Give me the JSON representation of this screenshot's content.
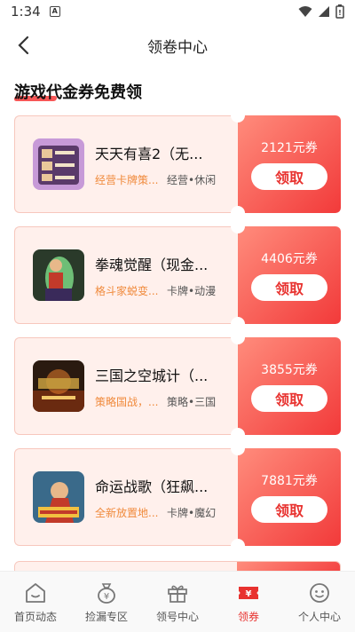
{
  "status_bar": {
    "time": "1:34",
    "badge": "A"
  },
  "nav": {
    "title": "领卷中心"
  },
  "section": {
    "title": "游戏代金券免费领"
  },
  "coupons": [
    {
      "name": "天天有喜2（无...",
      "desc": "经营卡牌策...",
      "tags": "经营•休闲",
      "amount": "2121元券",
      "button": "领取",
      "icon": "game-icon-tiantian"
    },
    {
      "name": "拳魂觉醒（现金...",
      "desc": "格斗家蜕变...",
      "tags": "卡牌•动漫",
      "amount": "4406元券",
      "button": "领取",
      "icon": "game-icon-quanhun"
    },
    {
      "name": "三国之空城计（...",
      "desc": "策略国战，...",
      "tags": "策略•三国",
      "amount": "3855元券",
      "button": "领取",
      "icon": "game-icon-sanguo"
    },
    {
      "name": "命运战歌（狂飙...",
      "desc": "全新放置地...",
      "tags": "卡牌•魔幻",
      "amount": "7881元券",
      "button": "领取",
      "icon": "game-icon-mingyun"
    }
  ],
  "tabs": [
    {
      "label": "首页动态",
      "icon": "home-face-icon",
      "active": false
    },
    {
      "label": "捡漏专区",
      "icon": "money-bag-icon",
      "active": false
    },
    {
      "label": "领号中心",
      "icon": "gift-icon",
      "active": false
    },
    {
      "label": "领券",
      "icon": "coupon-icon",
      "active": true
    },
    {
      "label": "个人中心",
      "icon": "profile-face-icon",
      "active": false
    }
  ],
  "colors": {
    "accent": "#e8322f",
    "coupon_bg": "#fff0ec",
    "desc": "#f08a3c"
  }
}
